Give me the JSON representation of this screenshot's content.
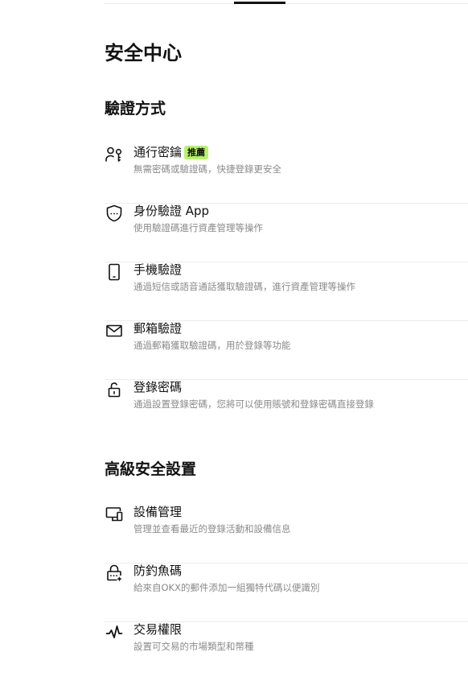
{
  "page": {
    "title": "安全中心"
  },
  "verification": {
    "title": "驗證方式",
    "items": [
      {
        "icon": "passkey-icon",
        "title": "通行密鑰",
        "badge": "推薦",
        "desc": "無需密碼或驗證碼，快捷登錄更安全"
      },
      {
        "icon": "authenticator-shield-icon",
        "title": "身份驗證 App",
        "desc": "使用驗證碼進行資產管理等操作"
      },
      {
        "icon": "phone-icon",
        "title": "手機驗證",
        "desc": "通過短信或語音通話獲取驗證碼，進行資產管理等操作"
      },
      {
        "icon": "email-icon",
        "title": "郵箱驗證",
        "desc": "通過郵箱獲取驗證碼，用於登錄等功能"
      },
      {
        "icon": "lock-icon",
        "title": "登錄密碼",
        "desc": "通過設置登錄密碼，您將可以使用賬號和登錄密碼直接登錄"
      }
    ]
  },
  "advanced": {
    "title": "高級安全設置",
    "items": [
      {
        "icon": "device-icon",
        "title": "設備管理",
        "desc": "管理並查看最近的登錄活動和設備信息"
      },
      {
        "icon": "anti-phishing-icon",
        "title": "防釣魚碼",
        "desc": "給來自OKX的郵件添加一組獨特代碼以便識別"
      },
      {
        "icon": "trading-pulse-icon",
        "title": "交易權限",
        "desc": "設置可交易的市場類型和幣種"
      }
    ]
  }
}
